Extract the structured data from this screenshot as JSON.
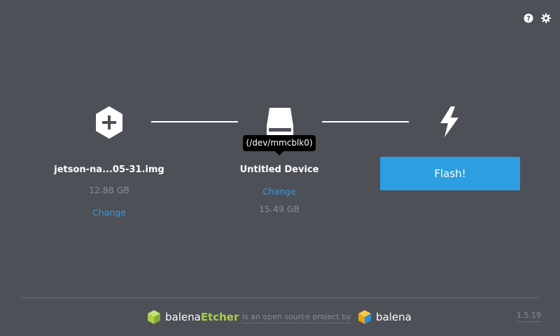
{
  "header": {
    "help_icon": "help-circle-icon",
    "settings_icon": "gear-icon"
  },
  "steps": {
    "image": {
      "icon": "plus-hexagon-icon",
      "name": "jetson-na...05-31.img",
      "size": "12.88 GB",
      "change_label": "Change"
    },
    "drive": {
      "icon": "drive-icon",
      "tooltip": "(/dev/mmcblk0)",
      "name": "Untitled Device",
      "change_label": "Change",
      "size": "15.49 GB"
    },
    "flash": {
      "icon": "lightning-icon",
      "button_label": "Flash!"
    }
  },
  "footer": {
    "etcher_brand_prefix": "balena",
    "etcher_brand_suffix": "Etcher",
    "tagline": "is an open source project by",
    "balena_brand": "balena",
    "version": "1.5.19"
  },
  "colors": {
    "background": "#4d5057",
    "accent": "#2d9ee0",
    "link": "#2f9ce0",
    "etcher_green": "#a8cf45",
    "muted_text": "#8b8d92"
  }
}
